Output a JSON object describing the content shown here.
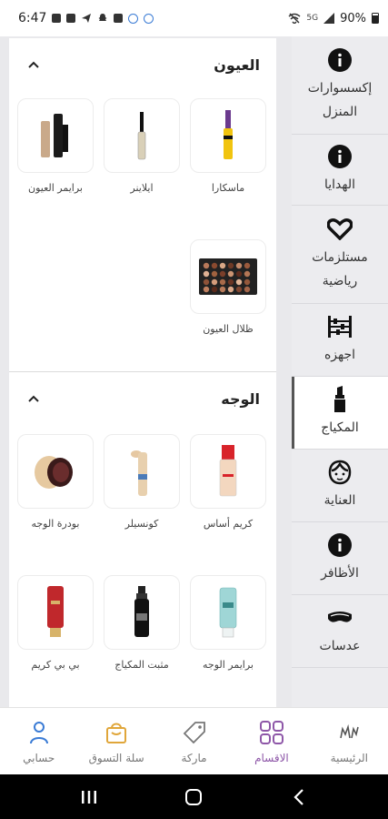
{
  "status_bar": {
    "time": "6:47",
    "network": "5G",
    "battery": "90%"
  },
  "sidebar": {
    "items": [
      {
        "label": "إكسسوارات المنزل",
        "icon": "info-circle-icon",
        "active": false
      },
      {
        "label": "الهدايا",
        "icon": "info-circle-icon",
        "active": false
      },
      {
        "label": "مستلزمات رياضية",
        "icon": "heart-outline-icon",
        "active": false
      },
      {
        "label": "اجهزه",
        "icon": "abacus-icon",
        "active": false
      },
      {
        "label": "المكياج",
        "icon": "lipstick-icon",
        "active": true
      },
      {
        "label": "العناية",
        "icon": "face-icon",
        "active": false
      },
      {
        "label": "الأظافر",
        "icon": "info-circle-icon",
        "active": false
      },
      {
        "label": "عدسات",
        "icon": "eye-mask-icon",
        "active": false
      }
    ]
  },
  "sections": [
    {
      "title": "العيون",
      "products": [
        {
          "name": "ماسكارا",
          "icon": "mascara-icon"
        },
        {
          "name": "ايلاينر",
          "icon": "eyeliner-icon"
        },
        {
          "name": "برايمر العيون",
          "icon": "eye-primer-icon"
        },
        {
          "name": "ظلال العيون",
          "icon": "eyeshadow-palette-icon"
        }
      ]
    },
    {
      "title": "الوجه",
      "products": [
        {
          "name": "كريم أساس",
          "icon": "foundation-icon"
        },
        {
          "name": "كونسيلر",
          "icon": "concealer-icon"
        },
        {
          "name": "بودرة الوجه",
          "icon": "face-powder-icon"
        },
        {
          "name": "برايمر الوجه",
          "icon": "face-primer-icon"
        },
        {
          "name": "مثبت المكياج",
          "icon": "setting-spray-icon"
        },
        {
          "name": "بي بي كريم",
          "icon": "bb-cream-icon"
        }
      ]
    }
  ],
  "bottom_nav": {
    "items": [
      {
        "label": "الرئيسية",
        "icon": "home-logo-icon",
        "active": false
      },
      {
        "label": "الاقسام",
        "icon": "grid-icon",
        "active": true
      },
      {
        "label": "ماركة",
        "icon": "tag-icon",
        "active": false
      },
      {
        "label": "سلة التسوق",
        "icon": "shopping-bag-icon",
        "active": false
      },
      {
        "label": "حسابي",
        "icon": "user-icon",
        "active": false
      }
    ]
  },
  "colors": {
    "accent": "#8e57a8",
    "cart_icon": "#e0a63a",
    "user_icon": "#3a7bd5"
  }
}
